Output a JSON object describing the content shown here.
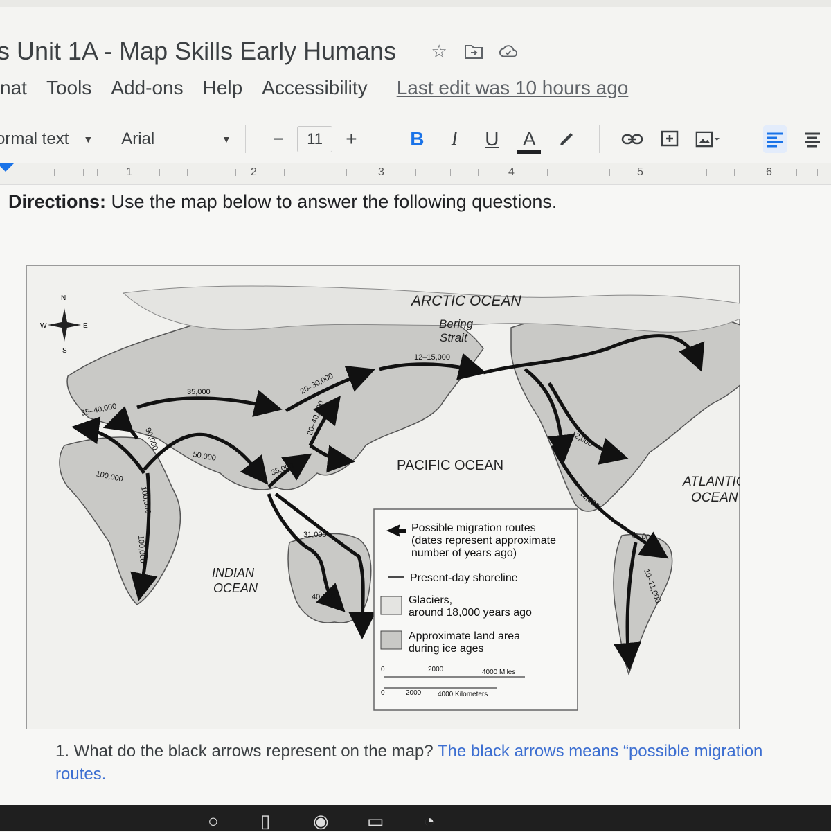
{
  "doc": {
    "title": "s Unit 1A - Map Skills Early Humans",
    "menu": [
      "nat",
      "Tools",
      "Add-ons",
      "Help",
      "Accessibility"
    ],
    "last_edit": "Last edit was 10 hours ago"
  },
  "toolbar": {
    "style": "ormal text",
    "font": "Arial",
    "minus": "−",
    "size": "11",
    "plus": "+",
    "bold": "B",
    "italic": "I",
    "underline": "U",
    "text_color": "A"
  },
  "ruler": {
    "numbers": [
      "1",
      "2",
      "3",
      "4",
      "5",
      "6"
    ]
  },
  "content": {
    "directions_label": "Directions:",
    "directions_text": " Use the map below to answer the following questions."
  },
  "map": {
    "compass": {
      "n": "N",
      "s": "S",
      "e": "E",
      "w": "W"
    },
    "oceans": {
      "arctic": "ARCTIC OCEAN",
      "pacific": "PACIFIC OCEAN",
      "atlantic_1": "ATLANTIC",
      "atlantic_2": "OCEAN",
      "indian_1": "INDIAN",
      "indian_2": "OCEAN"
    },
    "bering_1": "Bering",
    "bering_2": "Strait",
    "dates": {
      "bering": "12–15,000",
      "d35k": "35,000",
      "d20_30k": "20–30,000",
      "d35_40k": "35–40,000",
      "d90k": "90,000",
      "d50k": "50,000",
      "d100k": "100,000",
      "d100k_b": "100,000",
      "d100k_c": "100,000",
      "d30_40k": "30–40,000",
      "d35k_b": "35,000",
      "d12k": "12,000",
      "d12k_b": "12,000",
      "d11k": "11,000",
      "d10_11k": "10–11,000",
      "d31k": "31,000",
      "d40k": "40,000"
    },
    "legend": {
      "routes_1": "Possible migration routes",
      "routes_2": "(dates represent approximate",
      "routes_3": "number of years ago)",
      "shoreline": "Present-day shoreline",
      "glaciers_1": "Glaciers,",
      "glaciers_2": "around 18,000 years ago",
      "land_1": "Approximate land area",
      "land_2": "during ice ages",
      "scale_0": "0",
      "scale_miles_mid": "2000",
      "scale_miles_end": "4000 Miles",
      "scale_km_0": "0",
      "scale_km_mid": "2000",
      "scale_km_end": "4000 Kilometers"
    }
  },
  "question": {
    "text": "1. What do the black arrows represent on the map? ",
    "answer": "The black arrows  means “possible migration routes."
  }
}
